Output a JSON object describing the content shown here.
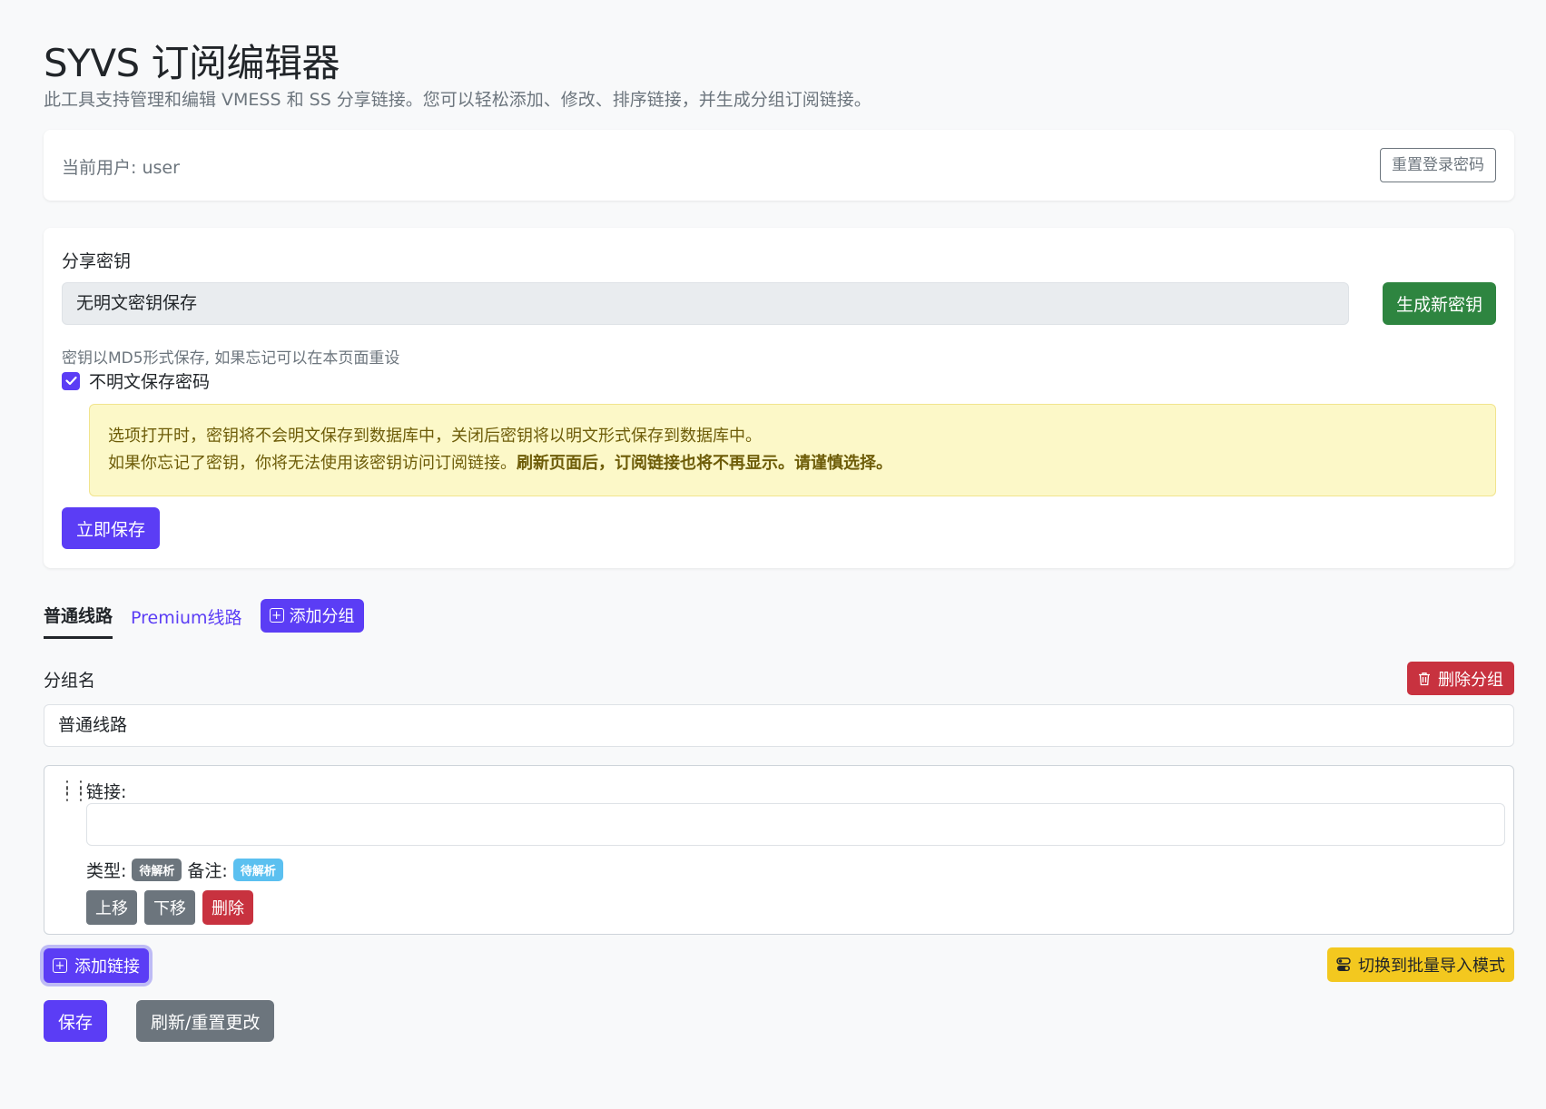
{
  "header": {
    "title": "SYVS 订阅编辑器",
    "subtitle": "此工具支持管理和编辑 VMESS 和 SS 分享链接。您可以轻松添加、修改、排序链接，并生成分组订阅链接。"
  },
  "user_card": {
    "user_label": "当前用户: user",
    "reset_password_label": "重置登录密码"
  },
  "key_card": {
    "label": "分享密钥",
    "input_value": "无明文密钥保存",
    "generate_label": "生成新密钥",
    "hint": "密钥以MD5形式保存, 如果忘记可以在本页面重设",
    "checkbox_label": "不明文保存密码",
    "checkbox_checked": true,
    "alert_line1": "选项打开时，密钥将不会明文保存到数据库中，关闭后密钥将以明文形式保存到数据库中。",
    "alert_line2_prefix": "如果你忘记了密钥，你将无法使用该密钥访问订阅链接。",
    "alert_line2_bold": "刷新页面后，订阅链接也将不再显示。请谨慎选择。",
    "save_now_label": "立即保存"
  },
  "tabs": {
    "items": [
      {
        "label": "普通线路",
        "active": true
      },
      {
        "label": "Premium线路",
        "active": false
      }
    ],
    "add_group_label": "添加分组"
  },
  "group": {
    "name_label": "分组名",
    "delete_group_label": "删除分组",
    "name_value": "普通线路"
  },
  "link_item": {
    "link_label": "链接:",
    "link_value": "",
    "type_label": "类型:",
    "type_badge": "待解析",
    "note_label": "备注:",
    "note_badge": "待解析",
    "move_up_label": "上移",
    "move_down_label": "下移",
    "delete_label": "删除"
  },
  "actions": {
    "add_link_label": "添加链接",
    "batch_mode_label": "切换到批量导入模式",
    "save_label": "保存",
    "reset_label": "刷新/重置更改"
  },
  "colors": {
    "primary": "#5b3df5",
    "success": "#2e8540",
    "danger": "#c8323f",
    "warning": "#f3c81f",
    "secondary": "#6c757d",
    "info": "#5bc0f0"
  }
}
